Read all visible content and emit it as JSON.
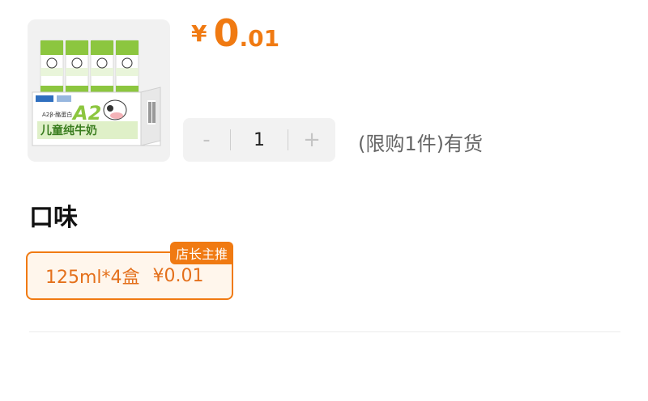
{
  "product": {
    "image_icon": "milk-carton-pack-image",
    "package_brand": "A2",
    "package_subtitle": "A2β-酪蛋白",
    "package_name": "儿童纯牛奶",
    "carton_label": "A2β-酪蛋白",
    "carton_name": "儿童纯牛奶"
  },
  "price": {
    "currency": "¥",
    "integer": "0",
    "decimal": ".01"
  },
  "quantity": {
    "minus_label": "-",
    "value": "1",
    "plus_label": "+"
  },
  "stock_text": "(限购1件)有货",
  "flavor_section": {
    "title": "口味",
    "options": [
      {
        "label": "125ml*4盒",
        "price": "¥0.01",
        "badge": "店长主推",
        "selected": true
      }
    ]
  },
  "colors": {
    "accent": "#f07a12",
    "accent_bg": "#fff6ec",
    "carton_green": "#8cc63f",
    "box_blue": "#2f6fbf"
  }
}
